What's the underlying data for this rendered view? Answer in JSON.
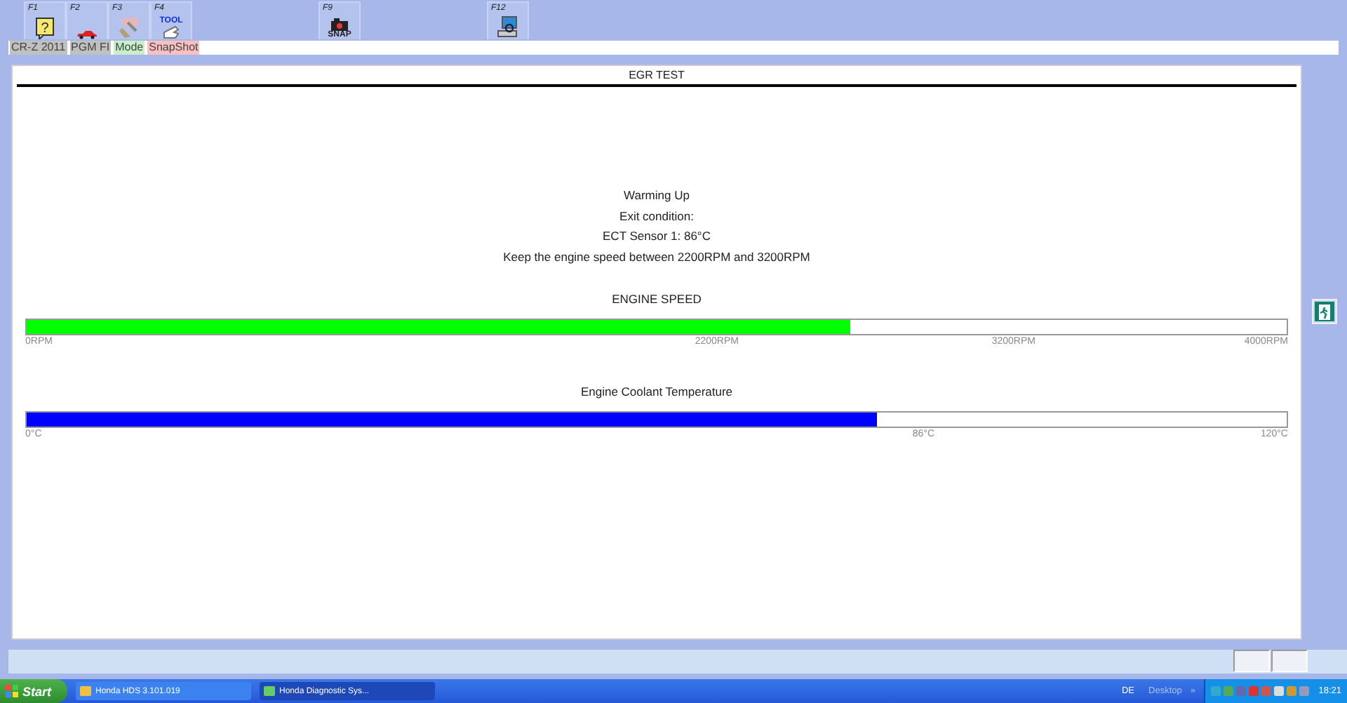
{
  "toolbar": {
    "buttons": [
      {
        "key": "F1",
        "kind": "help",
        "glyph": "?"
      },
      {
        "key": "F2",
        "kind": "car"
      },
      {
        "key": "F3",
        "kind": "tools"
      },
      {
        "key": "F4",
        "kind": "tool",
        "caption": "TOOL"
      },
      {
        "key": "F9",
        "kind": "snap",
        "caption": "SNAP"
      },
      {
        "key": "F12",
        "kind": "computer"
      }
    ]
  },
  "tags": [
    {
      "label": "CR-Z 2011",
      "color": "#c0c0c0"
    },
    {
      "label": "PGM FI",
      "color": "#c0c0c0"
    },
    {
      "label": "Mode",
      "color": "#c8f0c8"
    },
    {
      "label": "SnapShot",
      "color": "#f8c0c0"
    }
  ],
  "panel": {
    "title": "EGR TEST",
    "messages": [
      "Warming Up",
      "Exit condition:",
      "ECT Sensor 1: 86°C",
      "Keep the engine speed between 2200RPM and 3200RPM"
    ],
    "gauges": [
      {
        "title": "ENGINE SPEED",
        "color": "#00ff00",
        "level": 0.654,
        "ticks": [
          "0RPM",
          "2200RPM",
          "3200RPM",
          "4000RPM"
        ]
      },
      {
        "title": "Engine Coolant Temperature",
        "color": "#0000ff",
        "level": 0.675,
        "ticks": [
          "0°C",
          "86°C",
          "120°C"
        ]
      }
    ]
  },
  "taskbar": {
    "start": "Start",
    "tasks": [
      {
        "label": "Honda HDS 3.101.019",
        "selected": false
      },
      {
        "label": "Honda Diagnostic Sys...",
        "selected": true
      }
    ],
    "language": "DE",
    "desktop": "Desktop",
    "chevron": "»",
    "clock": "18:21"
  }
}
